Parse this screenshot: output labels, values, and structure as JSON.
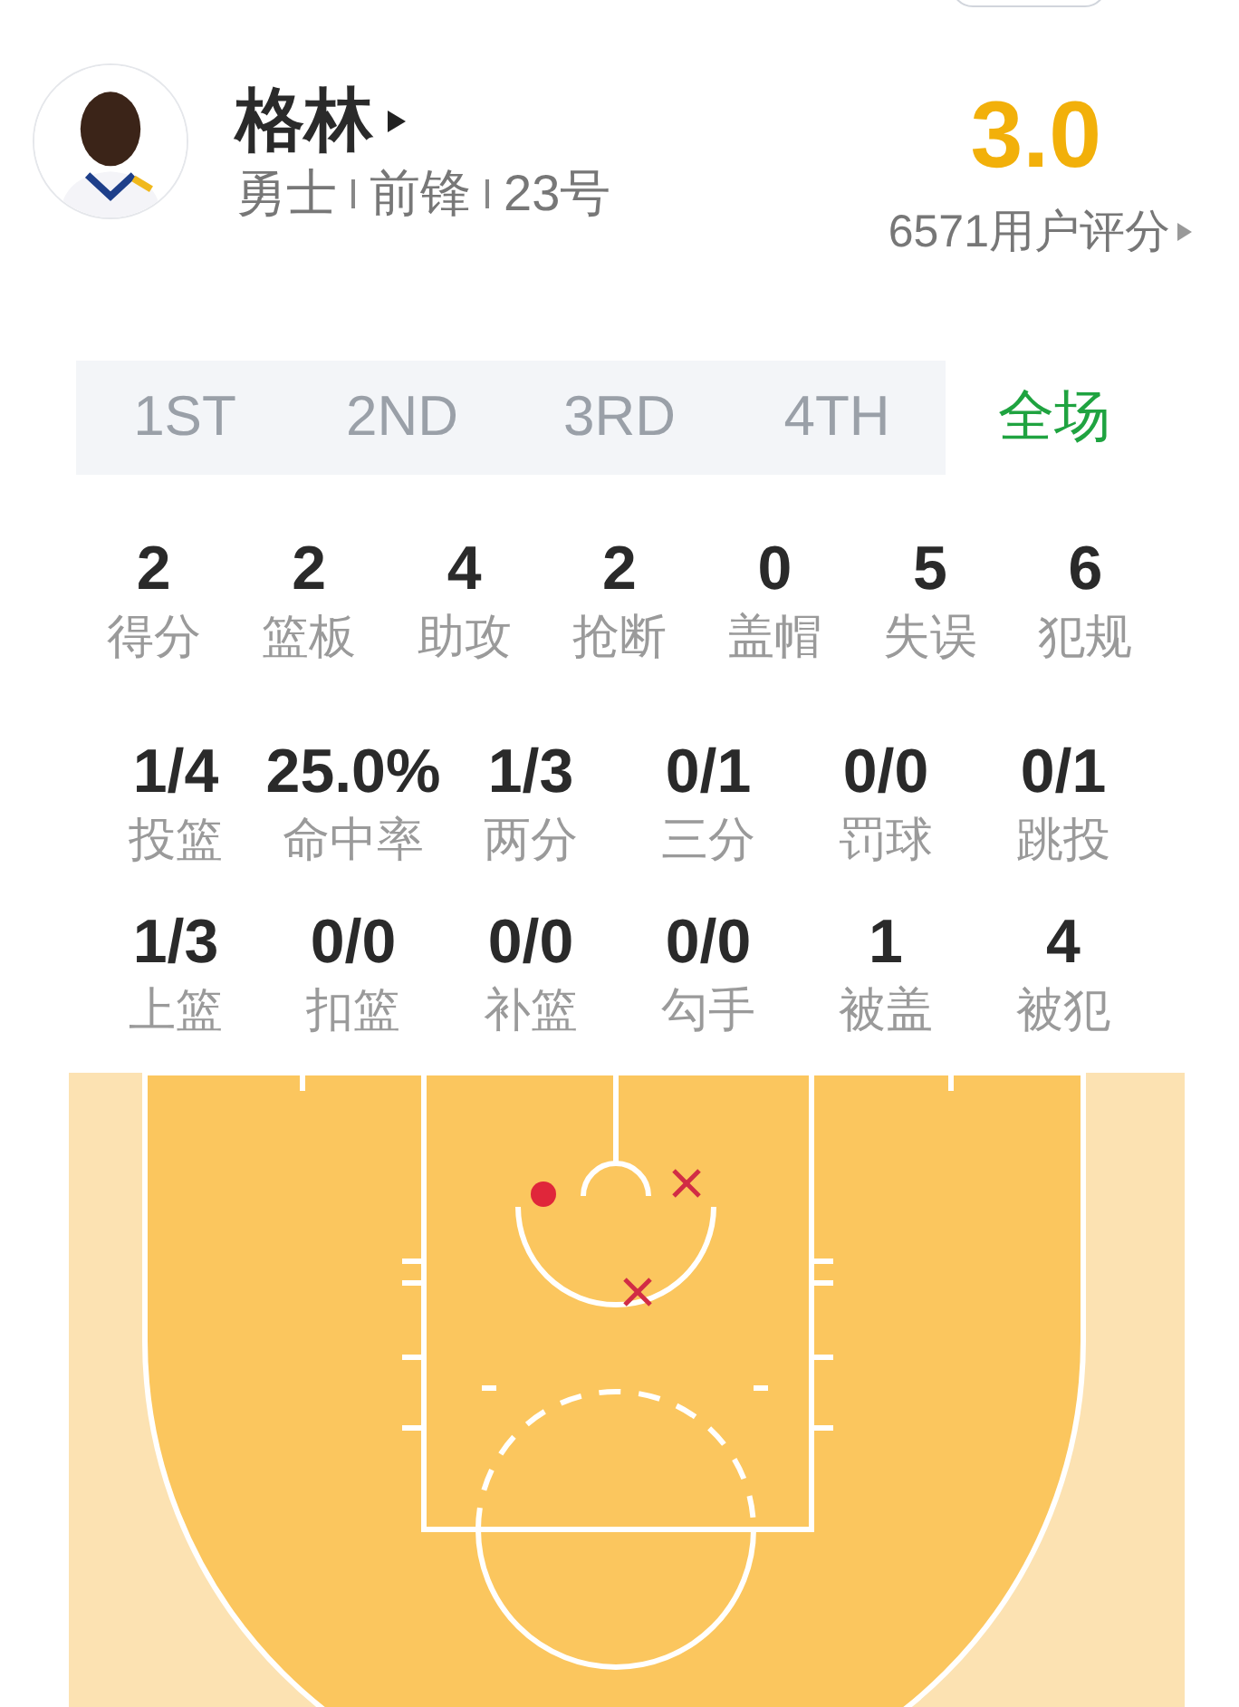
{
  "player": {
    "name": "格林",
    "team": "勇士",
    "position": "前锋",
    "number": "23号"
  },
  "rating": {
    "score": "3.0",
    "count": "6571用户评分"
  },
  "tabs": [
    {
      "label": "1ST",
      "selected": false
    },
    {
      "label": "2ND",
      "selected": false
    },
    {
      "label": "3RD",
      "selected": false
    },
    {
      "label": "4TH",
      "selected": false
    },
    {
      "label": "全场",
      "selected": true
    }
  ],
  "stat_rows": [
    [
      {
        "value": "2",
        "label": "得分"
      },
      {
        "value": "2",
        "label": "篮板"
      },
      {
        "value": "4",
        "label": "助攻"
      },
      {
        "value": "2",
        "label": "抢断"
      },
      {
        "value": "0",
        "label": "盖帽"
      },
      {
        "value": "5",
        "label": "失误"
      },
      {
        "value": "6",
        "label": "犯规"
      }
    ],
    [
      {
        "value": "1/4",
        "label": "投篮"
      },
      {
        "value": "25.0%",
        "label": "命中率"
      },
      {
        "value": "1/3",
        "label": "两分"
      },
      {
        "value": "0/1",
        "label": "三分"
      },
      {
        "value": "0/0",
        "label": "罚球"
      },
      {
        "value": "0/1",
        "label": "跳投"
      }
    ],
    [
      {
        "value": "1/3",
        "label": "上篮"
      },
      {
        "value": "0/0",
        "label": "扣篮"
      },
      {
        "value": "0/0",
        "label": "补篮"
      },
      {
        "value": "0/0",
        "label": "勾手"
      },
      {
        "value": "1",
        "label": "被盖"
      },
      {
        "value": "4",
        "label": "被犯"
      }
    ]
  ],
  "shots": [
    {
      "made": true
    },
    {
      "made": false
    },
    {
      "made": false
    }
  ]
}
